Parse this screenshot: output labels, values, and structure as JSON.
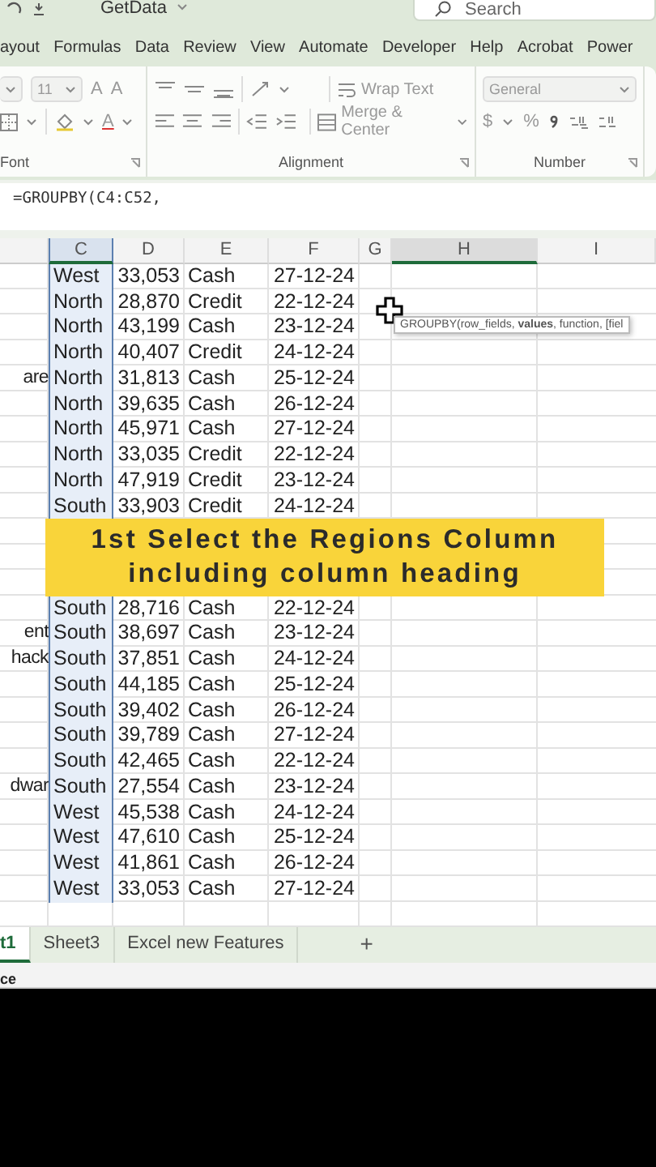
{
  "title_bar": {
    "file_name": "GetData",
    "search": {
      "placeholder": "Search"
    }
  },
  "ribbon_tabs": [
    {
      "label": "ayout",
      "selected": false
    },
    {
      "label": "Formulas",
      "selected": false
    },
    {
      "label": "Data",
      "selected": false
    },
    {
      "label": "Review",
      "selected": false
    },
    {
      "label": "View",
      "selected": false
    },
    {
      "label": "Automate",
      "selected": false
    },
    {
      "label": "Developer",
      "selected": false
    },
    {
      "label": "Help",
      "selected": false
    },
    {
      "label": "Acrobat",
      "selected": false
    },
    {
      "label": "Power",
      "selected": false
    }
  ],
  "ribbon": {
    "disabled": true,
    "font": {
      "size": "11",
      "grow": "A",
      "shrink": "A",
      "font_color": "A",
      "label": "Font"
    },
    "alignment": {
      "wrap_text": "Wrap Text",
      "merge": "Merge & Center",
      "label": "Alignment"
    },
    "number": {
      "format": "General",
      "currency": "$",
      "percent": "%",
      "label": "Number"
    }
  },
  "formula_bar": {
    "formula": "=GROUPBY(C4:C52,"
  },
  "sheet": {
    "columns": [
      {
        "label": "C",
        "selected": true,
        "highlighted": true
      },
      {
        "label": "D",
        "selected": false,
        "highlighted": false
      },
      {
        "label": "E",
        "selected": false,
        "highlighted": false
      },
      {
        "label": "F",
        "selected": false,
        "highlighted": false
      },
      {
        "label": "G",
        "selected": false,
        "highlighted": false
      },
      {
        "label": "H",
        "selected": false,
        "highlighted": true
      },
      {
        "label": "I",
        "selected": false,
        "highlighted": false
      }
    ],
    "rows_above": [
      {
        "c": "West",
        "d": "33,053",
        "e": "Cash",
        "f": "27-12-24"
      },
      {
        "c": "North",
        "d": "28,870",
        "e": "Credit",
        "f": "22-12-24"
      },
      {
        "c": "North",
        "d": "43,199",
        "e": "Cash",
        "f": "23-12-24"
      },
      {
        "c": "North",
        "d": "40,407",
        "e": "Credit",
        "f": "24-12-24"
      },
      {
        "b": "are",
        "c": "North",
        "d": "31,813",
        "e": "Cash",
        "f": "25-12-24"
      },
      {
        "c": "North",
        "d": "39,635",
        "e": "Cash",
        "f": "26-12-24"
      },
      {
        "c": "North",
        "d": "45,971",
        "e": "Cash",
        "f": "27-12-24"
      },
      {
        "c": "North",
        "d": "33,035",
        "e": "Credit",
        "f": "22-12-24"
      },
      {
        "c": "North",
        "d": "47,919",
        "e": "Credit",
        "f": "23-12-24"
      },
      {
        "c": "South",
        "d": "33,903",
        "e": "Credit",
        "f": "24-12-24"
      }
    ],
    "caption": {
      "lines": [
        "1st Select the Regions Column",
        "including column heading"
      ]
    },
    "rows_below": [
      {
        "c": "South",
        "d": "28,716",
        "e": "Cash",
        "f": "22-12-24"
      },
      {
        "b": "ent",
        "c": "South",
        "d": "38,697",
        "e": "Cash",
        "f": "23-12-24"
      },
      {
        "b": "hack",
        "c": "South",
        "d": "37,851",
        "e": "Cash",
        "f": "24-12-24"
      },
      {
        "c": "South",
        "d": "44,185",
        "e": "Cash",
        "f": "25-12-24"
      },
      {
        "c": "South",
        "d": "39,402",
        "e": "Cash",
        "f": "26-12-24"
      },
      {
        "c": "South",
        "d": "39,789",
        "e": "Cash",
        "f": "27-12-24"
      },
      {
        "c": "South",
        "d": "42,465",
        "e": "Cash",
        "f": "22-12-24"
      },
      {
        "b": "dwar",
        "c": "South",
        "d": "27,554",
        "e": "Cash",
        "f": "23-12-24"
      },
      {
        "c": "West",
        "d": "45,538",
        "e": "Cash",
        "f": "24-12-24"
      },
      {
        "c": "West",
        "d": "47,610",
        "e": "Cash",
        "f": "25-12-24"
      },
      {
        "c": "West",
        "d": "41,861",
        "e": "Cash",
        "f": "26-12-24"
      },
      {
        "c": "West",
        "d": "33,053",
        "e": "Cash",
        "f": "27-12-24"
      }
    ],
    "tooltip": "GROUPBY(row_fields, **values**, function, [fiel"
  },
  "sheet_tabs": [
    {
      "label": "t1",
      "selected": true
    },
    {
      "label": "Sheet3",
      "selected": false
    },
    {
      "label": "Excel new Features",
      "selected": false
    }
  ],
  "add_sheet": "+",
  "status_bar": {
    "text": "ce"
  }
}
